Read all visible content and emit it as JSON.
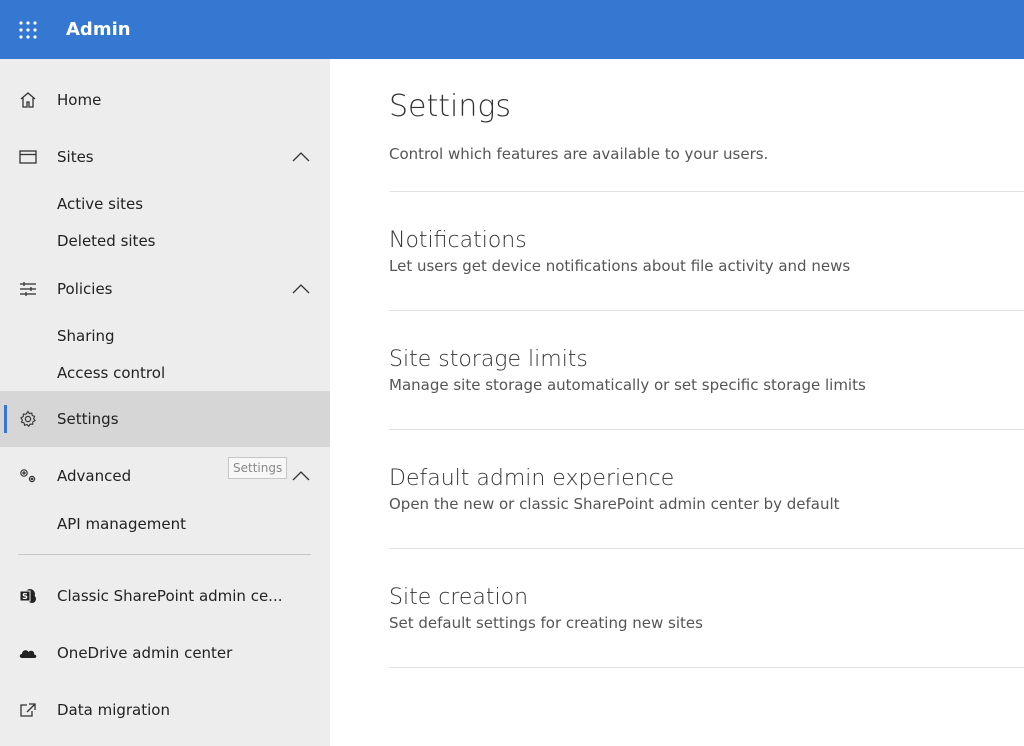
{
  "header": {
    "app_title": "Admin",
    "accent": "#3478d2"
  },
  "sidebar": {
    "items": [
      {
        "label": "Home",
        "icon": "home-icon"
      },
      {
        "label": "Sites",
        "icon": "browser-window-icon",
        "expanded": true
      },
      {
        "label": "Active sites"
      },
      {
        "label": "Deleted sites"
      },
      {
        "label": "Policies",
        "icon": "sliders-icon",
        "expanded": true
      },
      {
        "label": "Sharing"
      },
      {
        "label": "Access control"
      },
      {
        "label": "Settings",
        "icon": "gear-icon",
        "selected": true
      },
      {
        "label": "Advanced",
        "icon": "gears-icon",
        "expanded": true
      },
      {
        "label": "API management"
      },
      {
        "label": "Classic SharePoint admin ce...",
        "icon": "sharepoint-icon"
      },
      {
        "label": "OneDrive admin center",
        "icon": "onedrive-cloud-icon"
      },
      {
        "label": "Data migration",
        "icon": "external-link-icon"
      }
    ],
    "tooltip": "Settings"
  },
  "main": {
    "title": "Settings",
    "subtitle": "Control which features are available to your users.",
    "sections": [
      {
        "title": "Notifications",
        "description": "Let users get device notifications about file activity and news"
      },
      {
        "title": "Site storage limits",
        "description": "Manage site storage automatically or set specific storage limits"
      },
      {
        "title": "Default admin experience",
        "description": "Open the new or classic SharePoint admin center by default"
      },
      {
        "title": "Site creation",
        "description": "Set default settings for creating new sites"
      }
    ]
  }
}
